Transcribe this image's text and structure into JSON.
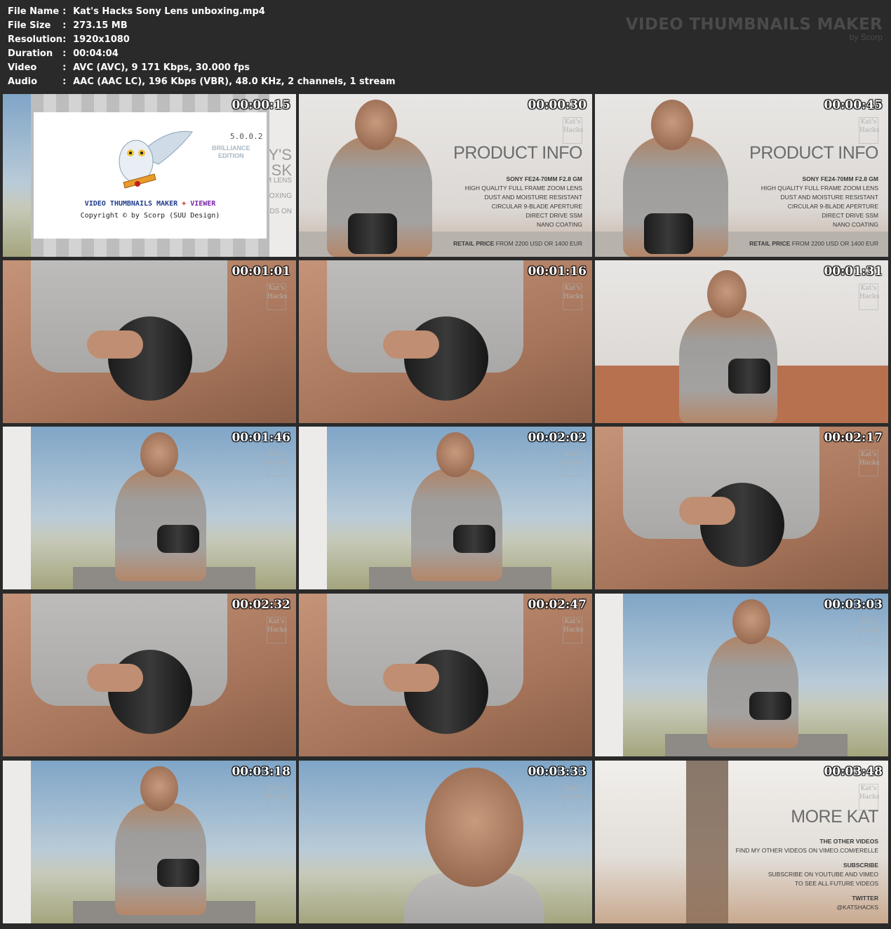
{
  "info": {
    "rows": [
      {
        "key": "File Name",
        "value": "Kat's Hacks Sony Lens unboxing.mp4"
      },
      {
        "key": "File Size",
        "value": "273.15 MB"
      },
      {
        "key": "Resolution",
        "value": "1920x1080"
      },
      {
        "key": "Duration",
        "value": "00:04:04"
      },
      {
        "key": "Video",
        "value": "AVC (AVC), 9 171 Kbps, 30.000 fps"
      },
      {
        "key": "Audio",
        "value": "AAC (AAC LC), 196 Kbps (VBR), 48.0 KHz, 2 channels, 1 stream"
      }
    ],
    "separator": ":"
  },
  "brand": {
    "title": "VIDEO THUMBNAILS MAKER",
    "subtitle": "by Scorp"
  },
  "splash": {
    "version": "5.0.0.2",
    "edition_line1": "BRILLIANCE",
    "edition_line2": "EDITION",
    "title_main": "VIDEO THUMBNAILS MAKER",
    "title_plus": " + ",
    "title_viewer": "VIEWER",
    "copyright": "Copyright © by Scorp (SUU Design)",
    "behind_text": [
      "Y'S",
      "SK",
      "M LENS",
      "OXING",
      "DS ON"
    ]
  },
  "product_info": {
    "heading": "PRODUCT INFO",
    "lines": [
      "SONY FE24-70mm F2.8 GM",
      "HIGH QUALITY FULL FRAME ZOOM LENS",
      "DUST AND MOISTURE RESISTANT",
      "CIRCULAR 9-BLADE APERTURE",
      "DIRECT DRIVE SSM",
      "NANO COATING"
    ],
    "price_label": "RETAIL PRICE",
    "price_value": "FROM 2200 USD OR 1400 EUR"
  },
  "more_kat": {
    "heading": "MORE KAT",
    "s1_title": "THE OTHER VIDEOS",
    "s1_text": "FIND MY OTHER VIDEOS ON VIMEO.COM/ERELLE",
    "s2_title": "SUBSCRIBE",
    "s2_text1": "SUBSCRIBE ON YOUTUBE AND VIMEO",
    "s2_text2": "TO SEE ALL FUTURE VIDEOS",
    "s3_title": "TWITTER",
    "s3_text": "@KatsHacks"
  },
  "logo_text": [
    "Kat's",
    "Hacks"
  ],
  "thumbnails": [
    {
      "time": "00:00:15",
      "scene": "splash"
    },
    {
      "time": "00:00:30",
      "scene": "product"
    },
    {
      "time": "00:00:45",
      "scene": "product"
    },
    {
      "time": "00:01:01",
      "scene": "closeup"
    },
    {
      "time": "00:01:16",
      "scene": "closeup"
    },
    {
      "time": "00:01:31",
      "scene": "wall"
    },
    {
      "time": "00:01:46",
      "scene": "sky"
    },
    {
      "time": "00:02:02",
      "scene": "sky"
    },
    {
      "time": "00:02:17",
      "scene": "closeup"
    },
    {
      "time": "00:02:32",
      "scene": "closeup"
    },
    {
      "time": "00:02:47",
      "scene": "closeup"
    },
    {
      "time": "00:03:03",
      "scene": "sky"
    },
    {
      "time": "00:03:18",
      "scene": "sky"
    },
    {
      "time": "00:03:33",
      "scene": "face"
    },
    {
      "time": "00:03:48",
      "scene": "morekat"
    }
  ]
}
